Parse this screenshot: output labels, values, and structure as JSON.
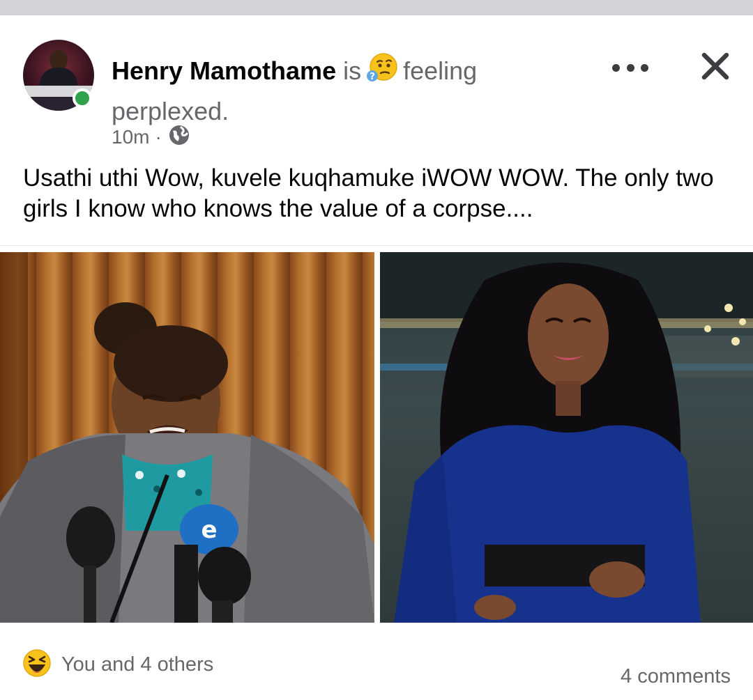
{
  "post": {
    "author": "Henry Mamothame",
    "is_word": "is",
    "feeling_word": "feeling",
    "feeling_value": "perplexed.",
    "time": "10m",
    "separator": "·",
    "privacy_icon": "globe-icon",
    "body": "Usathi uthi Wow, kuvele kuqhamuke iWOW WOW. The only two girls I know who knows the value of a corpse...."
  },
  "footer": {
    "reactions_label": "You and 4 others",
    "reaction_icon": "laughing-emoji-icon",
    "comments": "4 comments"
  },
  "colors": {
    "online": "#31a24c",
    "text_primary": "#050505",
    "text_secondary": "#65676b"
  }
}
